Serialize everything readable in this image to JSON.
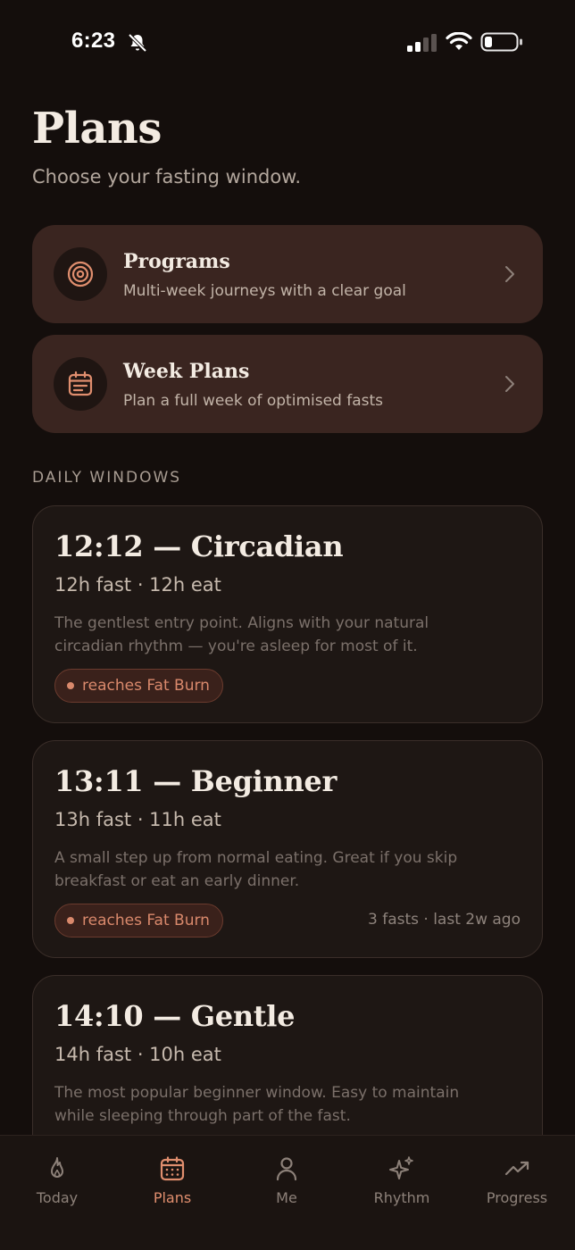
{
  "status_bar": {
    "time": "6:23"
  },
  "header": {
    "title": "Plans",
    "subtitle": "Choose your fasting window."
  },
  "nav_cards": [
    {
      "title": "Programs",
      "description": "Multi-week journeys with a clear goal",
      "icon": "target-icon"
    },
    {
      "title": "Week Plans",
      "description": "Plan a full week of optimised fasts",
      "icon": "calendar-icon"
    }
  ],
  "section_label": "DAILY WINDOWS",
  "plans": [
    {
      "title": "12:12 — Circadian",
      "subtitle": "12h fast · 12h eat",
      "description": "The gentlest entry point. Aligns with your natural circadian rhythm — you're asleep for most of it.",
      "badge": "reaches Fat Burn",
      "meta": ""
    },
    {
      "title": "13:11 — Beginner",
      "subtitle": "13h fast · 11h eat",
      "description": "A small step up from normal eating. Great if you skip breakfast or eat an early dinner.",
      "badge": "reaches Fat Burn",
      "meta": "3 fasts · last 2w ago"
    },
    {
      "title": "14:10 — Gentle",
      "subtitle": "14h fast · 10h eat",
      "description": "The most popular beginner window. Easy to maintain while sleeping through part of the fast.",
      "badge": "",
      "meta": ""
    }
  ],
  "tab_bar": {
    "active": "Plans",
    "tabs": [
      {
        "label": "Today",
        "icon": "flame-icon"
      },
      {
        "label": "Plans",
        "icon": "calendar-icon"
      },
      {
        "label": "Me",
        "icon": "person-icon"
      },
      {
        "label": "Rhythm",
        "icon": "sparkles-icon"
      },
      {
        "label": "Progress",
        "icon": "trend-up-icon"
      }
    ]
  },
  "colors": {
    "background": "#140e0c",
    "accent": "#e08e6e",
    "nav_card": "#3a2520",
    "plan_card": "#1e1714"
  }
}
